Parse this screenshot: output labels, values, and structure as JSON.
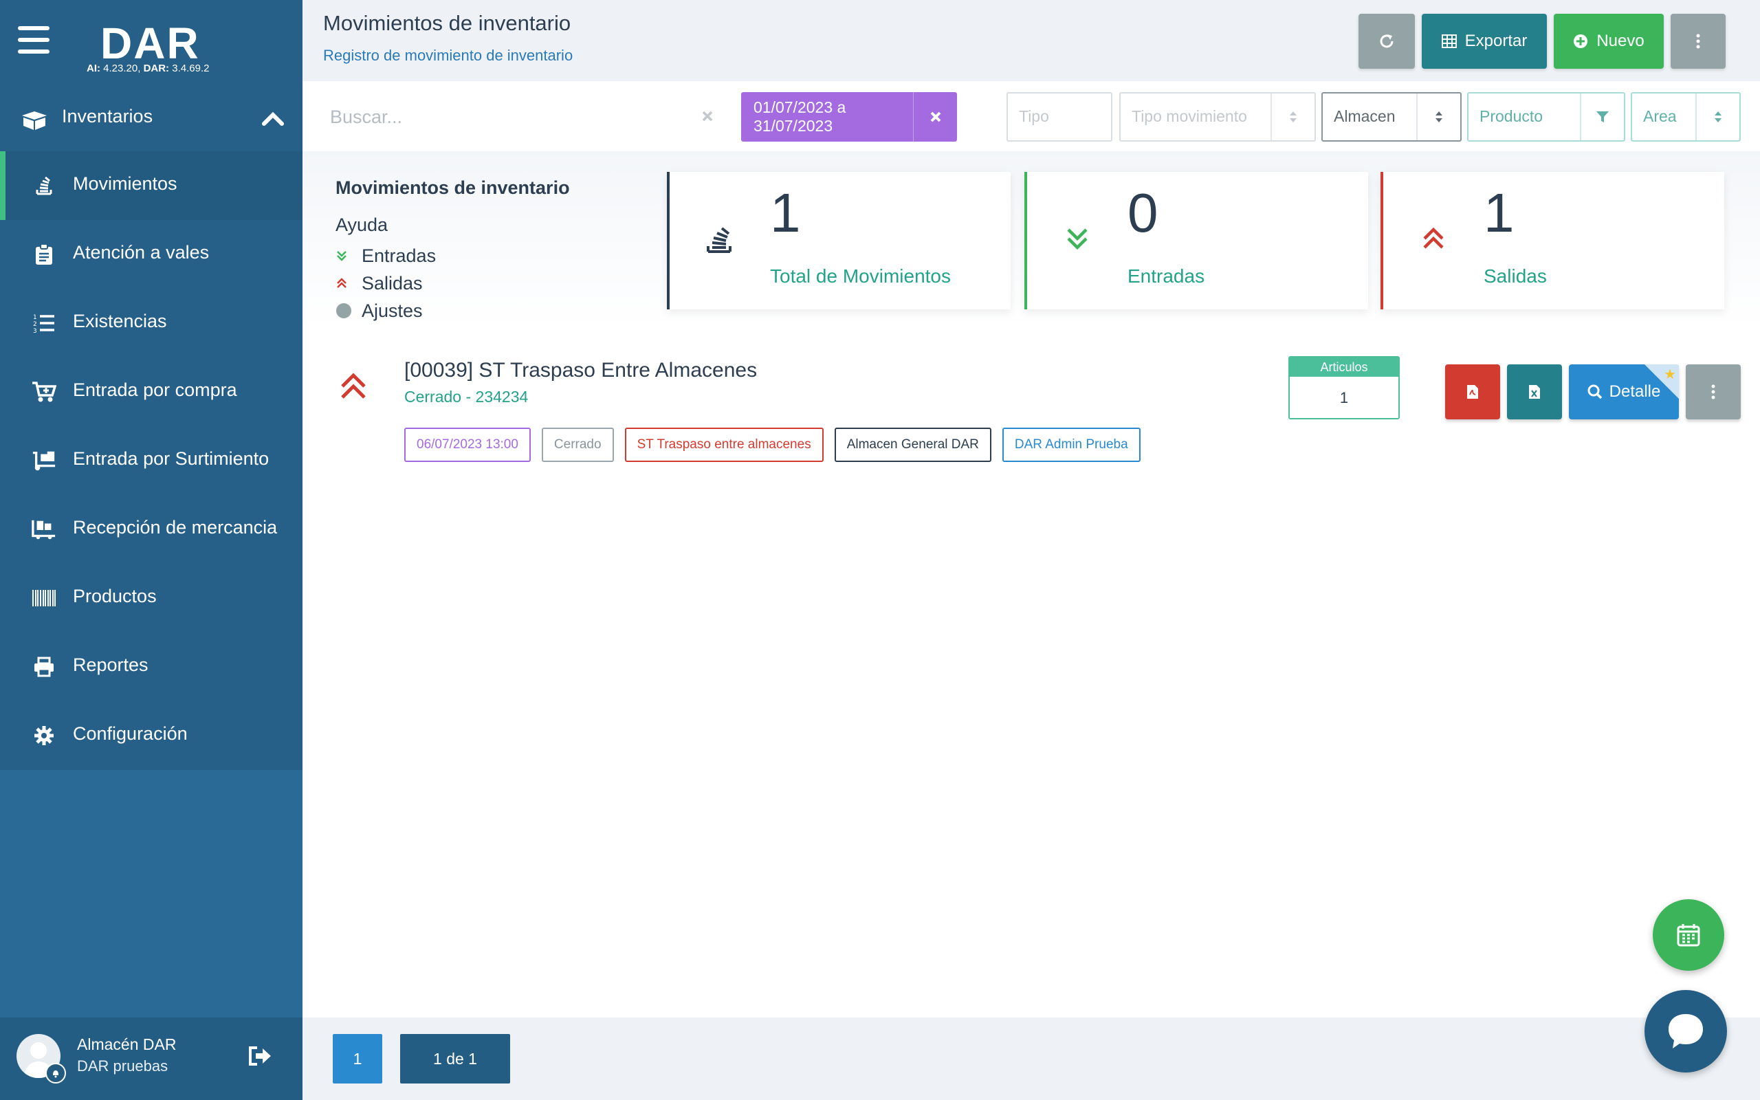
{
  "app": {
    "logo": "DAR",
    "version_ai_label": "AI:",
    "version_ai": "4.23.20,",
    "version_dar_label": "DAR:",
    "version_dar": "3.4.69.2"
  },
  "sidebar": {
    "section_label": "Inventarios",
    "items": [
      {
        "label": "Movimientos",
        "icon": "stack-icon",
        "active": true
      },
      {
        "label": "Atención a vales",
        "icon": "clipboard-icon"
      },
      {
        "label": "Existencias",
        "icon": "numbered-list-icon"
      },
      {
        "label": "Entrada por compra",
        "icon": "cart-icon"
      },
      {
        "label": "Entrada por Surtimiento",
        "icon": "dolly-icon"
      },
      {
        "label": "Recepción de mercancia",
        "icon": "pallet-icon"
      },
      {
        "label": "Productos",
        "icon": "barcode-icon"
      },
      {
        "label": "Reportes",
        "icon": "printer-icon"
      },
      {
        "label": "Configuración",
        "icon": "gear-icon"
      }
    ],
    "user": {
      "name": "Almacén DAR",
      "subtitle": "DAR pruebas"
    }
  },
  "header": {
    "title": "Movimientos de inventario",
    "subtitle": "Registro de movimiento de inventario",
    "export_label": "Exportar",
    "new_label": "Nuevo"
  },
  "filters": {
    "search_placeholder": "Buscar...",
    "date_range": "01/07/2023 a 31/07/2023",
    "tipo": "Tipo",
    "tipo_movimiento": "Tipo movimiento",
    "almacen": "Almacen",
    "producto": "Producto",
    "area": "Area"
  },
  "summary": {
    "title": "Movimientos de inventario",
    "help_label": "Ayuda",
    "legend": [
      "Entradas",
      "Salidas",
      "Ajustes"
    ],
    "cards": [
      {
        "value": "1",
        "label": "Total de Movimientos"
      },
      {
        "value": "0",
        "label": "Entradas"
      },
      {
        "value": "1",
        "label": "Salidas"
      }
    ]
  },
  "movements": [
    {
      "title": "[00039] ST Traspaso Entre Almacenes",
      "status": "Cerrado - 234234",
      "tags": [
        "06/07/2023 13:00",
        "Cerrado",
        "ST Traspaso entre almacenes",
        "Almacen General DAR",
        "DAR Admin Prueba"
      ],
      "articulos_label": "Articulos",
      "articulos": "1",
      "detail_label": "Detalle"
    }
  ],
  "pagination": {
    "current": "1",
    "info": "1 de 1"
  },
  "colors": {
    "sidebar": "#2a6a96",
    "accent_green": "#3cb55a",
    "accent_teal": "#24808a",
    "accent_red": "#d23b30",
    "accent_blue": "#2a8ad0",
    "accent_purple": "#a46be0"
  }
}
